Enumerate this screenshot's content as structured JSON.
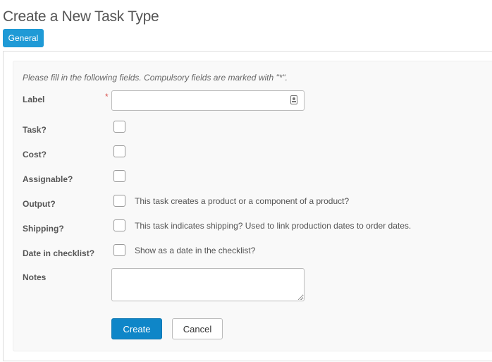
{
  "page": {
    "title": "Create a New Task Type"
  },
  "tabs": [
    {
      "label": "General",
      "active": true
    }
  ],
  "form": {
    "instructions": "Please fill in the following fields. Compulsory fields are marked with \"*\".",
    "required_marker": "*",
    "fields": {
      "label": {
        "label": "Label",
        "value": "",
        "placeholder": ""
      },
      "task": {
        "label": "Task?",
        "checked": false
      },
      "cost": {
        "label": "Cost?",
        "checked": false
      },
      "assignable": {
        "label": "Assignable?",
        "checked": false
      },
      "output": {
        "label": "Output?",
        "checked": false,
        "hint": "This task creates a product or a component of a product?"
      },
      "shipping": {
        "label": "Shipping?",
        "checked": false,
        "hint": "This task indicates shipping? Used to link production dates to order dates."
      },
      "date_in_checklist": {
        "label": "Date in checklist?",
        "checked": false,
        "hint": "Show as a date in the checklist?"
      },
      "notes": {
        "label": "Notes",
        "value": ""
      }
    },
    "buttons": {
      "create": "Create",
      "cancel": "Cancel"
    }
  },
  "colors": {
    "primary": "#0f86c8",
    "tab_active": "#1f9ad6",
    "required": "#d9534f"
  },
  "icons": {
    "label_input": "contact-card-icon"
  }
}
